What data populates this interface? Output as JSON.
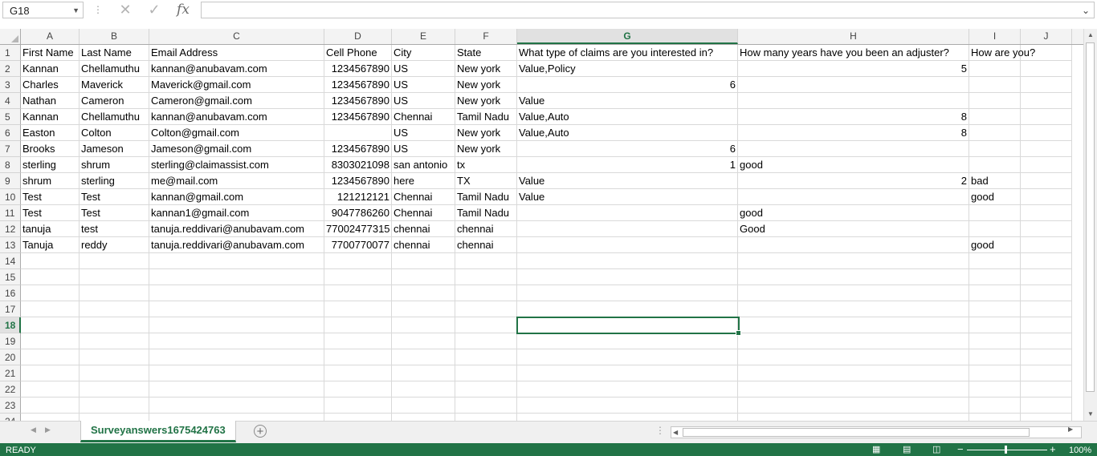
{
  "formula_bar": {
    "name_box": "G18",
    "formula": "",
    "fx": "fx"
  },
  "columns": [
    {
      "label": "A",
      "selected": false
    },
    {
      "label": "B",
      "selected": false
    },
    {
      "label": "C",
      "selected": false
    },
    {
      "label": "D",
      "selected": false
    },
    {
      "label": "E",
      "selected": false
    },
    {
      "label": "F",
      "selected": false
    },
    {
      "label": "G",
      "selected": true
    },
    {
      "label": "H",
      "selected": false
    },
    {
      "label": "I",
      "selected": false
    },
    {
      "label": "J",
      "selected": false
    }
  ],
  "rows": [
    {
      "n": "1",
      "cells": [
        "First Name",
        "Last Name",
        "Email Address",
        "Cell Phone",
        "City",
        "State",
        "What type of claims are you interested in?",
        "How many years have you been an adjuster?",
        "How are you?",
        ""
      ]
    },
    {
      "n": "2",
      "cells": [
        "Kannan",
        "Chellamuthu",
        "kannan@anubavam.com",
        "1234567890",
        "US",
        "New york",
        "Value,Policy",
        "5",
        "",
        ""
      ]
    },
    {
      "n": "3",
      "cells": [
        "Charles",
        "Maverick",
        "Maverick@gmail.com",
        "1234567890",
        "US",
        "New york",
        "6",
        "",
        "",
        ""
      ]
    },
    {
      "n": "4",
      "cells": [
        "Nathan",
        "Cameron",
        "Cameron@gmail.com",
        "1234567890",
        "US",
        "New york",
        "Value",
        "",
        "",
        ""
      ]
    },
    {
      "n": "5",
      "cells": [
        "Kannan",
        "Chellamuthu",
        "kannan@anubavam.com",
        "1234567890",
        "Chennai",
        "Tamil Nadu",
        "Value,Auto",
        "8",
        "",
        ""
      ]
    },
    {
      "n": "6",
      "cells": [
        "Easton",
        "Colton",
        "Colton@gmail.com",
        "",
        "US",
        "New york",
        "Value,Auto",
        "8",
        "",
        ""
      ]
    },
    {
      "n": "7",
      "cells": [
        "Brooks",
        "Jameson",
        "Jameson@gmail.com",
        "1234567890",
        "US",
        "New york",
        "6",
        "",
        "",
        ""
      ]
    },
    {
      "n": "8",
      "cells": [
        "sterling",
        "shrum",
        "sterling@claimassist.com",
        "8303021098",
        "san antonio",
        "tx",
        "1",
        "good",
        "",
        ""
      ]
    },
    {
      "n": "9",
      "cells": [
        "shrum",
        "sterling",
        "me@mail.com",
        "1234567890",
        "here",
        "TX",
        "Value",
        "2",
        "bad",
        ""
      ]
    },
    {
      "n": "10",
      "cells": [
        "Test",
        "Test",
        "kannan@gmail.com",
        "121212121",
        "Chennai",
        "Tamil Nadu",
        "Value",
        "",
        "good",
        ""
      ]
    },
    {
      "n": "11",
      "cells": [
        "Test",
        "Test",
        "kannan1@gmail.com",
        "9047786260",
        "Chennai",
        "Tamil Nadu",
        "",
        "good",
        "",
        ""
      ]
    },
    {
      "n": "12",
      "cells": [
        "tanuja",
        "test",
        "tanuja.reddivari@anubavam.com",
        "77002477315",
        "chennai",
        "chennai",
        "",
        "Good",
        "",
        ""
      ]
    },
    {
      "n": "13",
      "cells": [
        "Tanuja",
        "reddy",
        "tanuja.reddivari@anubavam.com",
        "7700770077",
        "chennai",
        "chennai",
        "",
        "",
        "good",
        ""
      ]
    },
    {
      "n": "14",
      "cells": [
        "",
        "",
        "",
        "",
        "",
        "",
        "",
        "",
        "",
        ""
      ]
    },
    {
      "n": "15",
      "cells": [
        "",
        "",
        "",
        "",
        "",
        "",
        "",
        "",
        "",
        ""
      ]
    },
    {
      "n": "16",
      "cells": [
        "",
        "",
        "",
        "",
        "",
        "",
        "",
        "",
        "",
        ""
      ]
    },
    {
      "n": "17",
      "cells": [
        "",
        "",
        "",
        "",
        "",
        "",
        "",
        "",
        "",
        ""
      ]
    },
    {
      "n": "18",
      "cells": [
        "",
        "",
        "",
        "",
        "",
        "",
        "",
        "",
        "",
        ""
      ]
    },
    {
      "n": "19",
      "cells": [
        "",
        "",
        "",
        "",
        "",
        "",
        "",
        "",
        "",
        ""
      ]
    },
    {
      "n": "20",
      "cells": [
        "",
        "",
        "",
        "",
        "",
        "",
        "",
        "",
        "",
        ""
      ]
    },
    {
      "n": "21",
      "cells": [
        "",
        "",
        "",
        "",
        "",
        "",
        "",
        "",
        "",
        ""
      ]
    },
    {
      "n": "22",
      "cells": [
        "",
        "",
        "",
        "",
        "",
        "",
        "",
        "",
        "",
        ""
      ]
    },
    {
      "n": "23",
      "cells": [
        "",
        "",
        "",
        "",
        "",
        "",
        "",
        "",
        "",
        ""
      ]
    },
    {
      "n": "24",
      "cells": [
        "",
        "",
        "",
        "",
        "",
        "",
        "",
        "",
        "",
        ""
      ]
    }
  ],
  "selected_row": "18",
  "sheet_tab": "Surveyanswers1675424763",
  "status": {
    "text": "READY",
    "zoom": "100%"
  },
  "colors": {
    "accent": "#217346"
  }
}
